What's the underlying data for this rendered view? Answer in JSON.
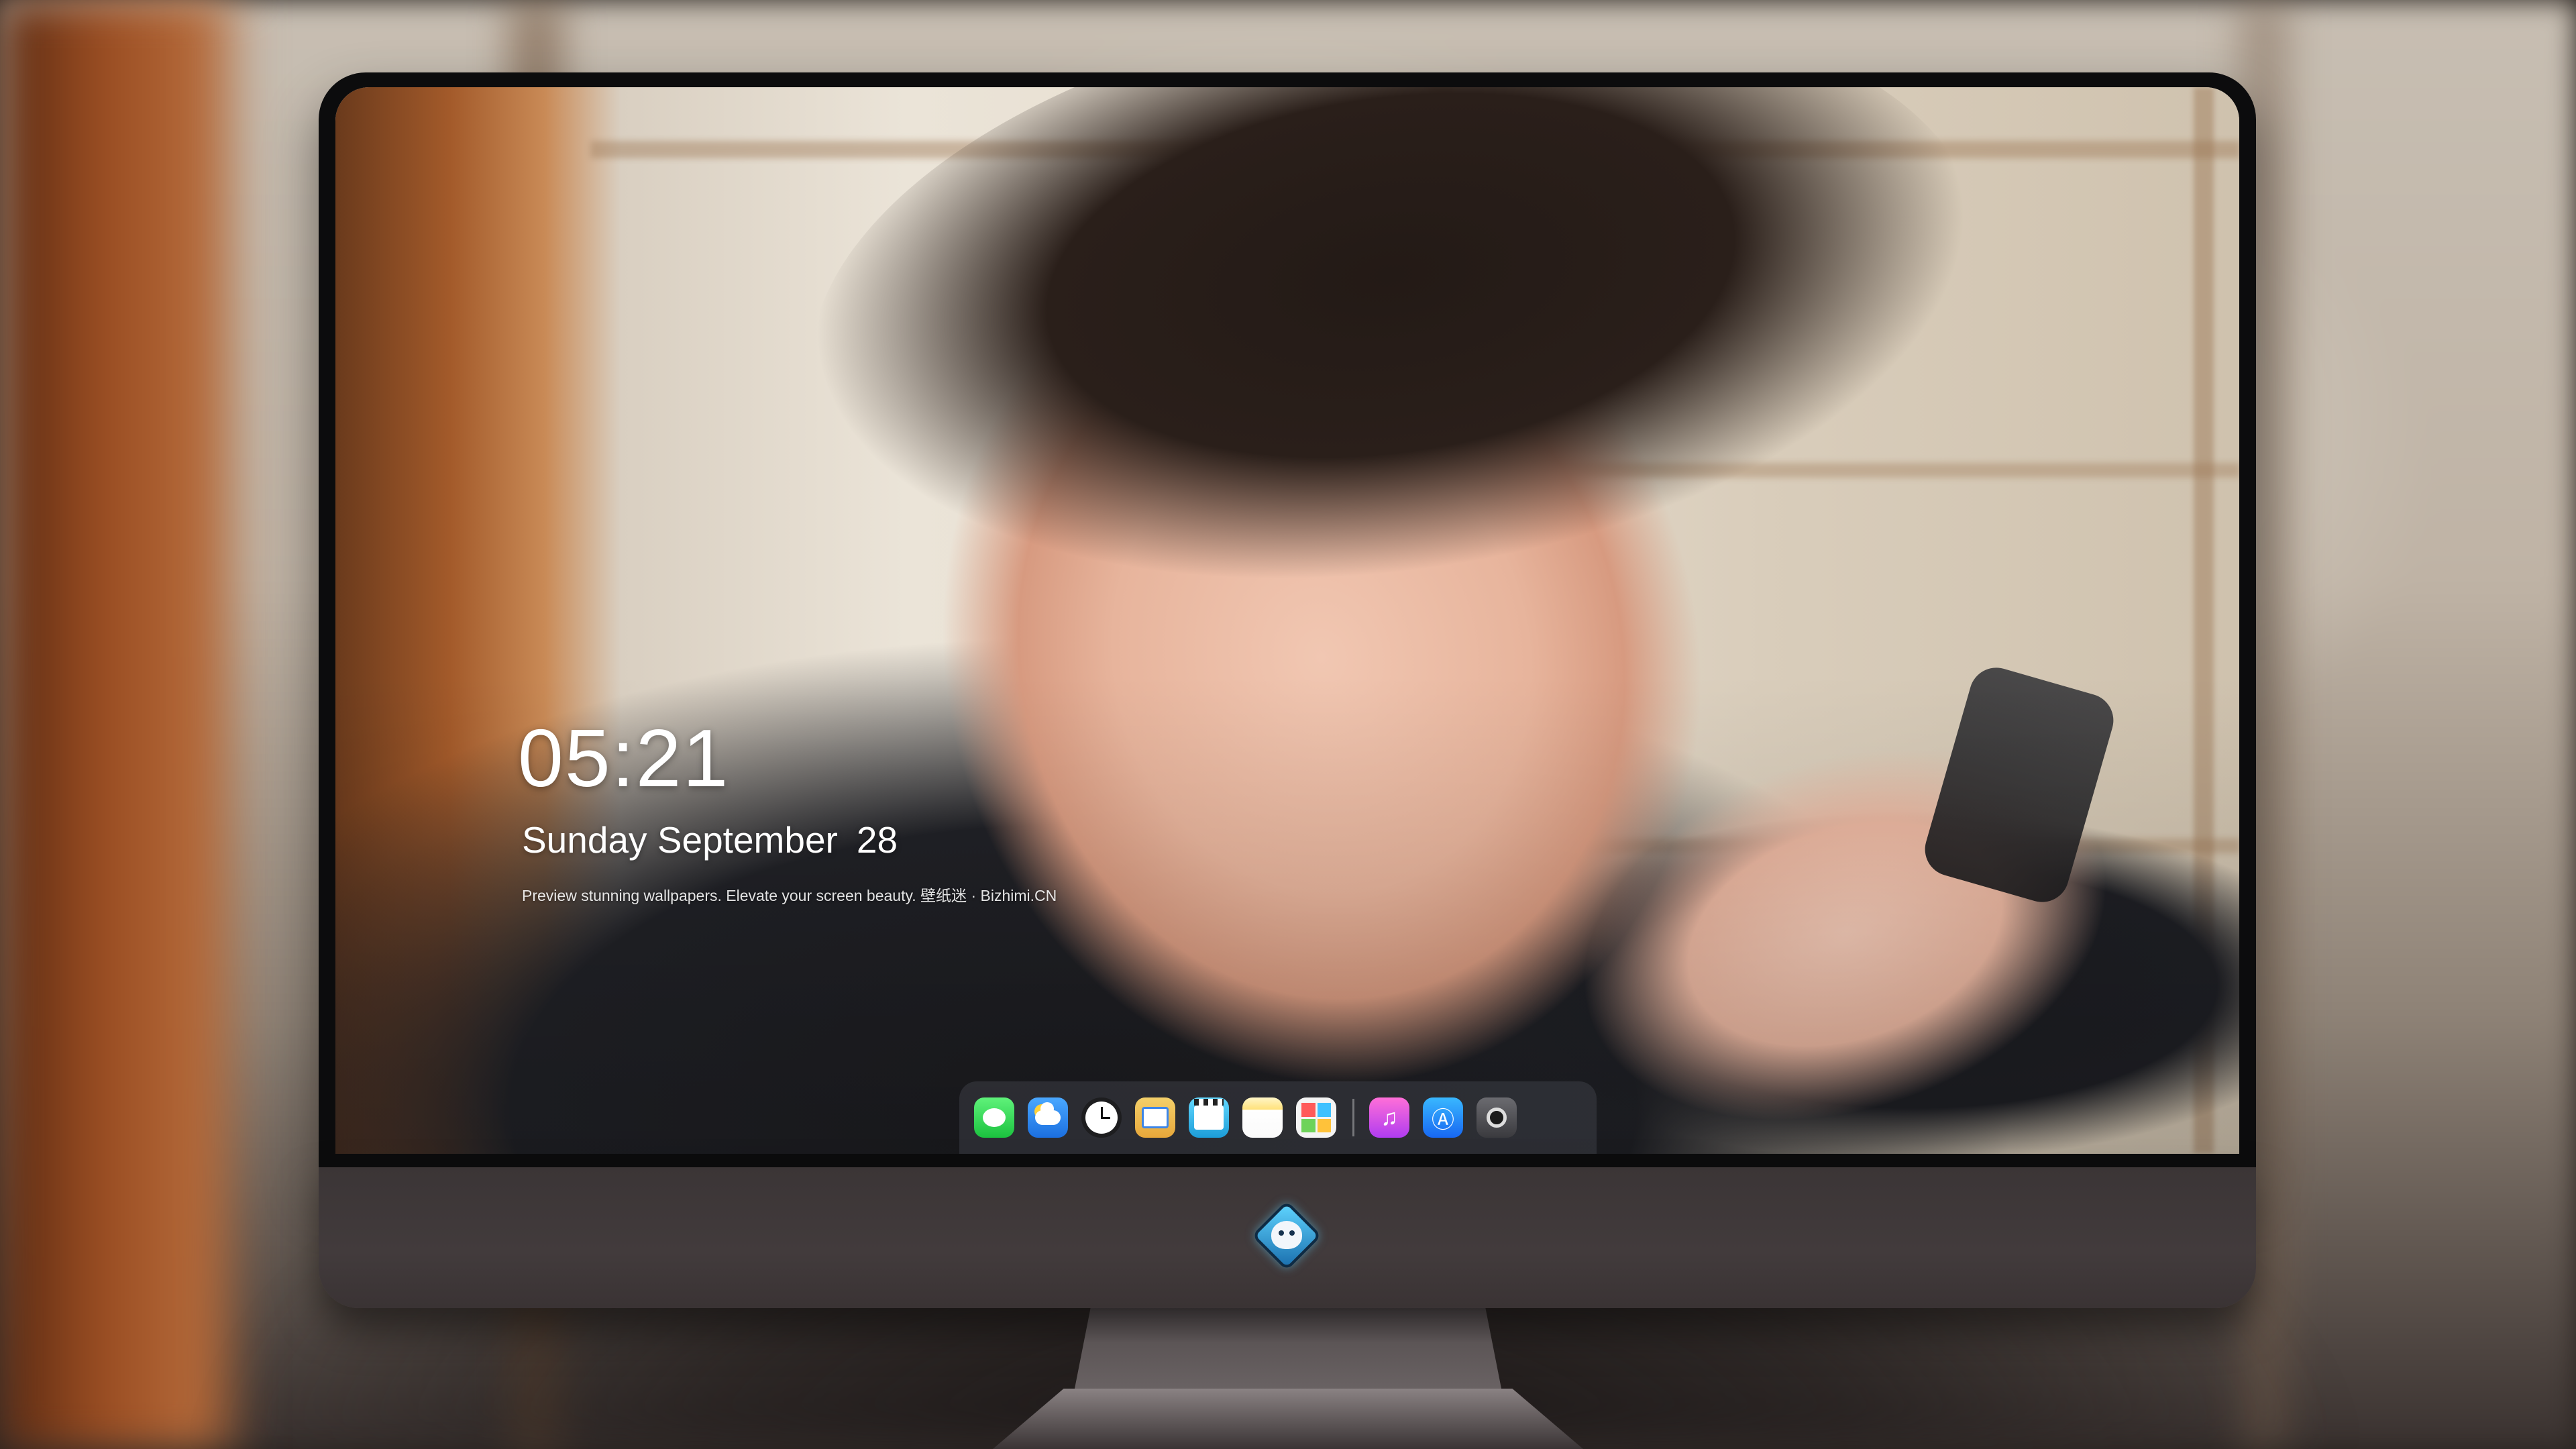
{
  "lock_screen": {
    "time": "05:21",
    "weekday_month": "Sunday September",
    "day": "28",
    "tagline": "Preview stunning wallpapers. Elevate your screen beauty. 壁纸迷 · Bizhimi.CN"
  },
  "dock": {
    "apps": [
      {
        "name": "messages",
        "icon": "messages-icon"
      },
      {
        "name": "weather",
        "icon": "weather-icon"
      },
      {
        "name": "clock",
        "icon": "clock-icon"
      },
      {
        "name": "preview",
        "icon": "preview-icon"
      },
      {
        "name": "video",
        "icon": "clapperboard-icon"
      },
      {
        "name": "notes",
        "icon": "notes-icon"
      },
      {
        "name": "photos",
        "icon": "photos-icon"
      },
      {
        "name": "music",
        "icon": "music-note-icon"
      },
      {
        "name": "app-store",
        "icon": "app-store-icon"
      },
      {
        "name": "camera",
        "icon": "camera-icon"
      }
    ],
    "music_glyph": "♫",
    "appstore_glyph": "Ⓐ"
  },
  "colors": {
    "dock_background": "#3c3e46",
    "bezel": "#0c0c0d",
    "chin": "#3b3536",
    "text": "#ffffff"
  }
}
